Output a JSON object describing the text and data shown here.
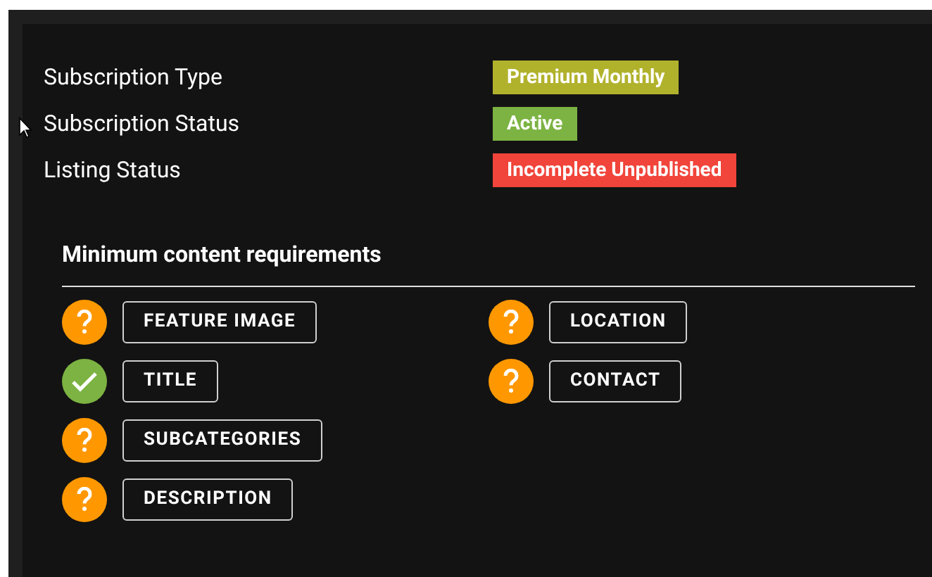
{
  "details": [
    {
      "label": "Subscription Type",
      "value": "Premium Monthly",
      "color": "#b1b22c"
    },
    {
      "label": "Subscription Status",
      "value": "Active",
      "color": "#7cb342"
    },
    {
      "label": "Listing Status",
      "value": "Incomplete Unpublished",
      "color": "#f1443a"
    }
  ],
  "requirements": {
    "title": "Minimum content requirements",
    "columns": [
      [
        {
          "label": "FEATURE IMAGE",
          "complete": false
        },
        {
          "label": "TITLE",
          "complete": true
        },
        {
          "label": "SUBCATEGORIES",
          "complete": false
        },
        {
          "label": "DESCRIPTION",
          "complete": false
        }
      ],
      [
        {
          "label": "LOCATION",
          "complete": false
        },
        {
          "label": "CONTACT",
          "complete": false
        }
      ]
    ]
  }
}
